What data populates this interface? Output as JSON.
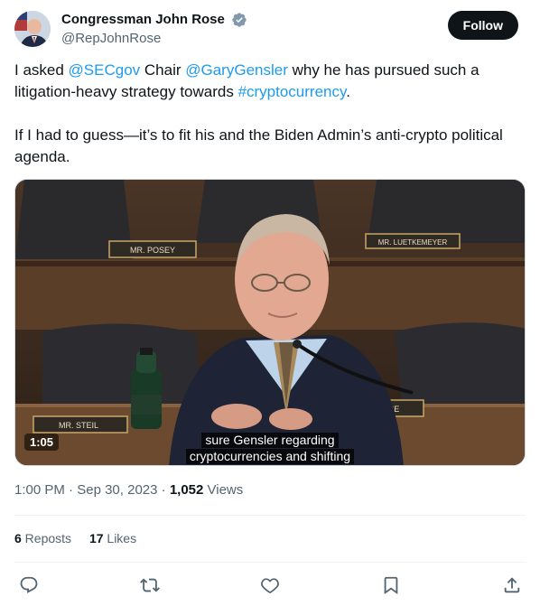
{
  "author": {
    "display_name": "Congressman John Rose",
    "handle": "@RepJohnRose",
    "verified_icon": "verified-badge-icon"
  },
  "follow_label": "Follow",
  "tweet": {
    "line1_pre": "I asked ",
    "mention1": "@SECgov",
    "line1_mid": " Chair ",
    "mention2": "@GaryGensler",
    "line1_post": " why he has pursued such a litigation-heavy strategy towards ",
    "hashtag": "#cryptocurrency",
    "line1_end": ".",
    "paragraph2": "If I had to guess—it’s to fit his and the Biden Admin’s anti-crypto political agenda."
  },
  "video": {
    "duration": "1:05",
    "caption_line1": "sure Gensler regarding",
    "caption_line2": "cryptocurrencies and shifting",
    "nameplates": {
      "posey": "MR. POSEY",
      "luetkemeyer": "MR. LUETKEMEYER",
      "steil": "MR. STEIL",
      "rose": "MR. ROSE"
    }
  },
  "meta": {
    "time": "1:00 PM",
    "sep": " · ",
    "date": "Sep 30, 2023",
    "views_count": "1,052",
    "views_label": " Views"
  },
  "stats": {
    "reposts_count": "6",
    "reposts_label": " Reposts",
    "likes_count": "17",
    "likes_label": " Likes"
  },
  "actions": [
    "reply-icon",
    "repost-icon",
    "like-icon",
    "bookmark-icon",
    "share-icon"
  ],
  "colors": {
    "link": "#1d9bf0",
    "text": "#0f1419",
    "secondary": "#536471",
    "verified": "#829aab"
  }
}
